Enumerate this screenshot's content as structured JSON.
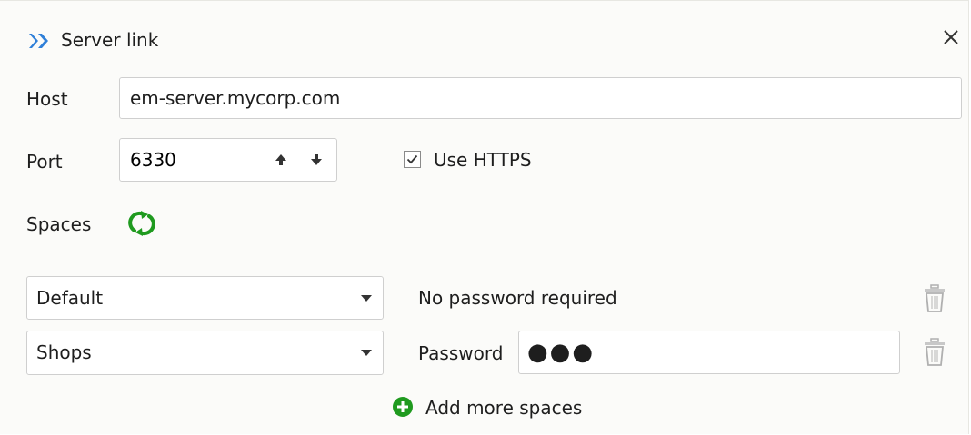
{
  "dialog": {
    "title": "Server link",
    "close_icon": "close-icon",
    "app_icon": "chevron-double-right-icon"
  },
  "colors": {
    "brand_blue": "#2f7fd8",
    "green_accent": "#1f9a1f",
    "field_border": "#cfcfcf",
    "panel_bg": "#fbfbf9"
  },
  "host": {
    "label": "Host",
    "value": "em-server.mycorp.com"
  },
  "port": {
    "label": "Port",
    "value": "6330",
    "up_icon": "arrow-up-icon",
    "down_icon": "arrow-down-icon"
  },
  "https": {
    "label": "Use HTTPS",
    "checked": true
  },
  "spaces": {
    "label": "Spaces",
    "refresh_icon": "refresh-icon",
    "items": [
      {
        "name": "Default",
        "auth_text": "No password required",
        "delete_icon": "trash-icon"
      },
      {
        "name": "Shops",
        "password_label": "Password",
        "password_value": "●●●",
        "delete_icon": "trash-icon"
      }
    ],
    "add_label": "Add more spaces",
    "add_icon": "plus-circle-icon"
  }
}
